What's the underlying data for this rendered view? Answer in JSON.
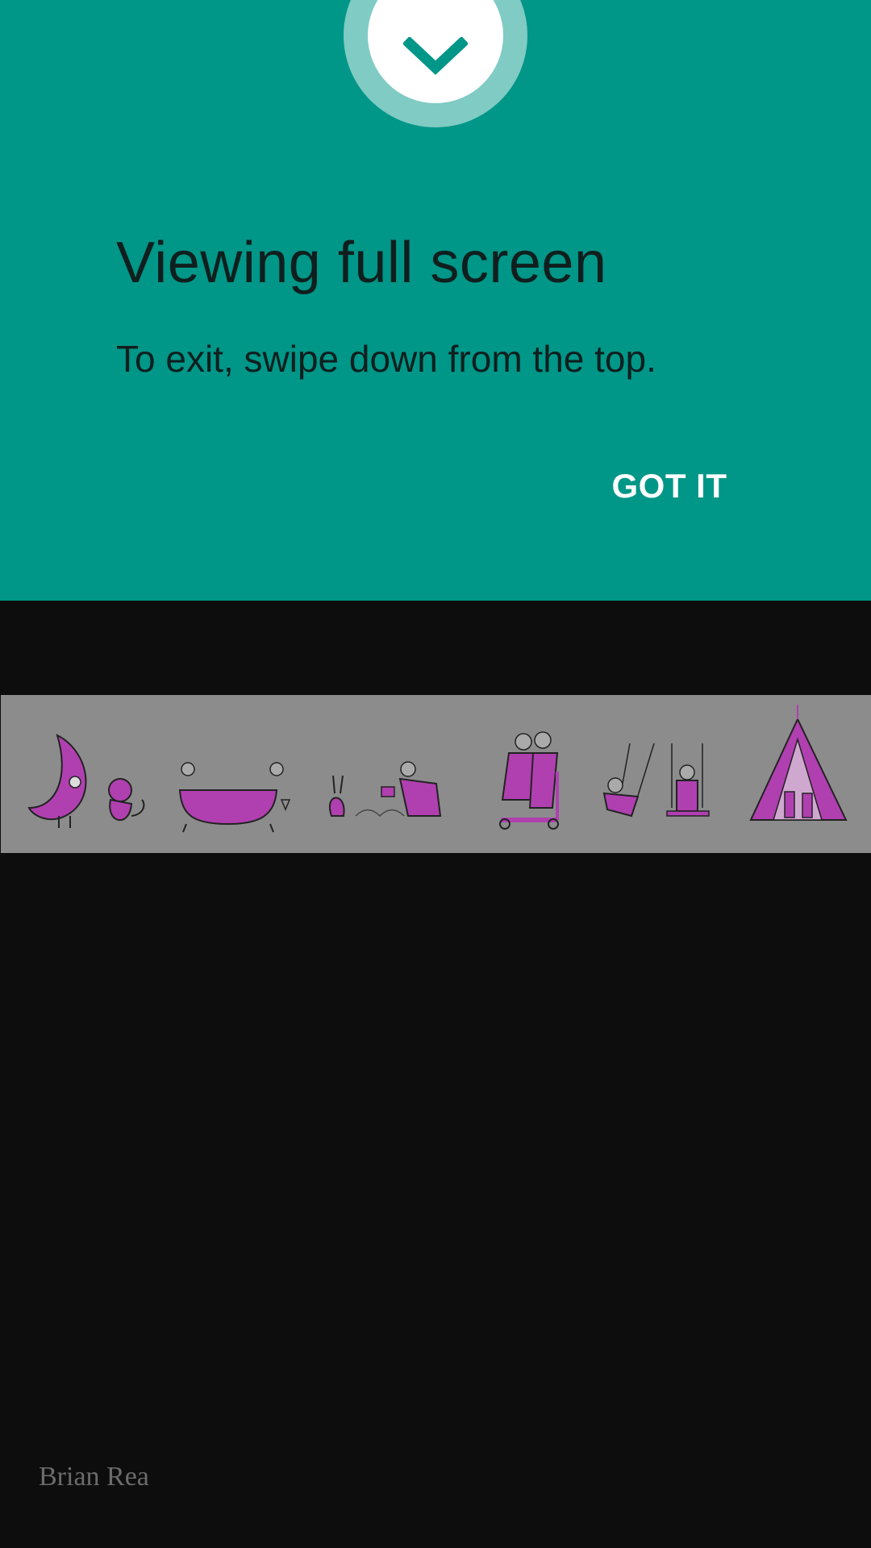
{
  "dialog": {
    "title": "Viewing full screen",
    "message": "To exit, swipe down from the top.",
    "button_label": "GOT IT",
    "icon": "chevron-down-icon",
    "colors": {
      "background": "#009688",
      "ring": "#80cbc4",
      "chevron": "#009688"
    }
  },
  "illustration": {
    "artist": "Brian Rea",
    "accent": "#b040b0"
  }
}
